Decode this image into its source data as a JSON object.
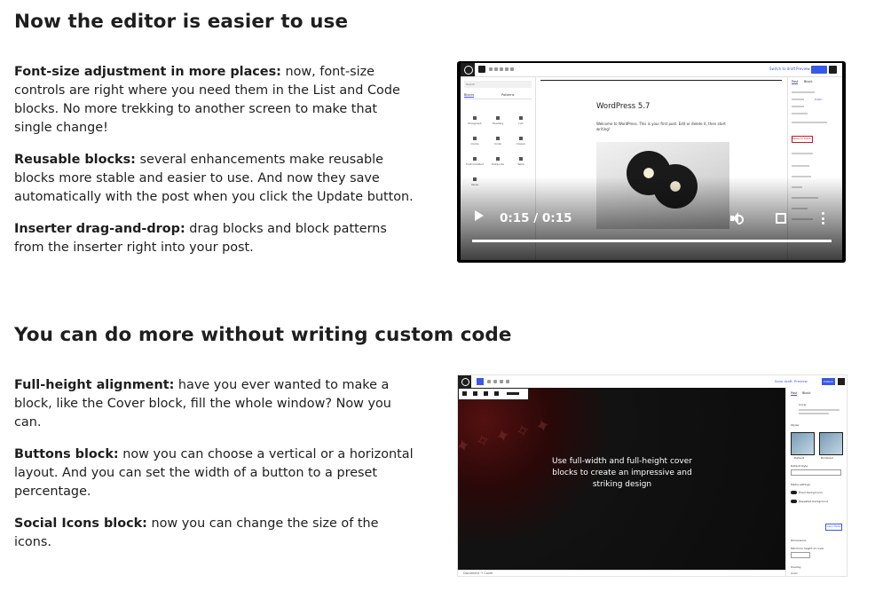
{
  "section1": {
    "heading": "Now the editor is easier to use",
    "items": [
      {
        "title": "Font-size adjustment in more places:",
        "text": " now, font-size controls are right where you need them in the List and Code blocks. No more trekking to another screen to make that single change!"
      },
      {
        "title": "Reusable blocks:",
        "text": " several enhancements make reusable blocks more stable and easier to use. And now they save automatically with the post when you click the Update button."
      },
      {
        "title": "Inserter drag-and-drop:",
        "text": " drag blocks and block patterns from the inserter right into your post."
      }
    ],
    "video": {
      "time_display": "0:15 / 0:15",
      "progress": 1.0,
      "editor": {
        "post_title": "WordPress 5.7",
        "post_paragraph": "Welcome to WordPress. This is your first post. Edit or delete it, then start writing!",
        "toolbar_links": [
          "Switch to draft",
          "Preview",
          "Update"
        ],
        "inserter_search": "Search",
        "inserter_tabs": [
          "Blocks",
          "Patterns"
        ],
        "inserter_blocks": [
          "Paragraph",
          "Heading",
          "List",
          "Quote",
          "Code",
          "Classic",
          "Preformatted",
          "Pullquote",
          "Table",
          "Verse"
        ],
        "settings_tabs": [
          "Post",
          "Block"
        ],
        "settings_labels": [
          "Status & visibility",
          "Visibility",
          "Public",
          "Publish",
          "Post format",
          "Stick to the top of the blog",
          "Move to trash",
          "2 Revisions",
          "Permalink",
          "Categories",
          "Tags",
          "Featured image",
          "Excerpt",
          "Discussion"
        ]
      }
    }
  },
  "section2": {
    "heading": "You can do more without writing custom code",
    "items": [
      {
        "title": "Full-height alignment:",
        "text": " have you ever wanted to make a block, like the Cover block, fill the whole window? Now you can."
      },
      {
        "title": "Buttons block:",
        "text": " now you can choose a vertical or a horizontal layout. And you can set the width of a button to a preset percentage."
      },
      {
        "title": "Social Icons block:",
        "text": " now you can change the size of the icons."
      }
    ],
    "screenshot": {
      "cover_text": "Use full-width and full-height cover blocks to create an impressive and striking design",
      "toolbar_links": [
        "Save draft",
        "Preview",
        "Publish"
      ],
      "sidebar_tabs": [
        "Post",
        "Block"
      ],
      "sidebar_labels": [
        "Cover",
        "Styles",
        "Default",
        "Bordered",
        "Default style",
        "Media settings",
        "Fixed background",
        "Repeated background",
        "Clear Media",
        "Dimensions",
        "Minimum height of cover",
        "Overlay",
        "Color"
      ],
      "footer_breadcrumb": "Document → Cover"
    }
  },
  "colors": {
    "accent": "#3858e9",
    "text": "#1e1e1e",
    "danger": "#cc1818"
  }
}
